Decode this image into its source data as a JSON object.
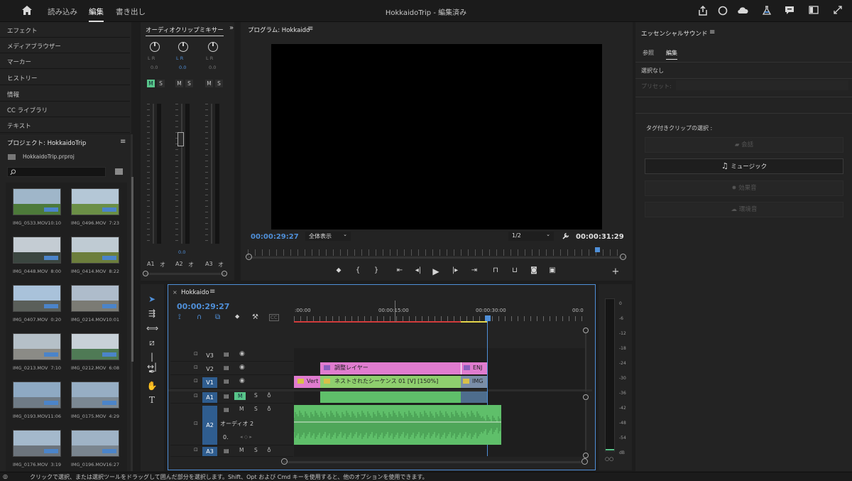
{
  "app": {
    "title": "HokkaidoTrip - 編集済み",
    "workspace_tabs": [
      "読み込み",
      "編集",
      "書き出し"
    ],
    "active_tab": "編集"
  },
  "left_nav": {
    "items": [
      "エフェクト",
      "メディアブラウザー",
      "マーカー",
      "ヒストリー",
      "情報",
      "CC ライブラリ",
      "テキスト"
    ]
  },
  "project": {
    "title": "プロジェクト: HokkaidoTrip",
    "file": "HokkaidoTrip.prproj",
    "search_placeholder": "",
    "clips": [
      {
        "name": "IMG_0533.MOV",
        "duration": "10:10",
        "sky": "#9fb6c9",
        "ground": "#4d7a3a"
      },
      {
        "name": "IMG_0496.MOV",
        "duration": "7:23",
        "sky": "#b4c7d6",
        "ground": "#6b8f46"
      },
      {
        "name": "IMG_0448.MOV",
        "duration": "8:00",
        "sky": "#c4ccd3",
        "ground": "#3b4640"
      },
      {
        "name": "IMG_0414.MOV",
        "duration": "8:22",
        "sky": "#bfcbd3",
        "ground": "#6c7e3c"
      },
      {
        "name": "IMG_0407.MOV",
        "duration": "0:20",
        "sky": "#a9c2da",
        "ground": "#5a5f5a"
      },
      {
        "name": "IMG_0214.MOV",
        "duration": "10:01",
        "sky": "#aebccb",
        "ground": "#7b7b74"
      },
      {
        "name": "IMG_0213.MOV",
        "duration": "7:10",
        "sky": "#b5c0c8",
        "ground": "#8b8b86"
      },
      {
        "name": "IMG_0212.MOV",
        "duration": "6:08",
        "sky": "#c8d1d8",
        "ground": "#4f7a55"
      },
      {
        "name": "IMG_0193.MOV",
        "duration": "11:06",
        "sky": "#8ea9c3",
        "ground": "#6f7b86"
      },
      {
        "name": "IMG_0175.MOV",
        "duration": "4:29",
        "sky": "#97aec4",
        "ground": "#7b8893"
      },
      {
        "name": "IMG_0176.MOV",
        "duration": "3:19",
        "sky": "#a4b9cc",
        "ground": "#6c747c"
      },
      {
        "name": "IMG_0196.MOV",
        "duration": "16:27",
        "sky": "#9fb3c6",
        "ground": "#7a858f"
      }
    ]
  },
  "mixer": {
    "title": "オーディオクリップミキサー",
    "channels": [
      {
        "name": "A1",
        "value": "0.0",
        "lr": "L  R",
        "fader_value": ""
      },
      {
        "name": "A2",
        "value": "0.0",
        "lr": "L  R",
        "fader_value": "0.0"
      },
      {
        "name": "A3",
        "value": "0.0",
        "lr": "L  R",
        "fader_value": ""
      }
    ],
    "m_label": "M",
    "s_label": "S",
    "mark_label": "オ"
  },
  "program": {
    "title": "プログラム: Hokkaido",
    "current_time": "00:00:29:27",
    "fit": "全体表示",
    "resolution": "1/2",
    "duration": "00:00:31:29"
  },
  "essential_sound": {
    "title": "エッセンシャルサウンド",
    "tabs": [
      "参照",
      "編集"
    ],
    "active_tab": "編集",
    "selection": "選択なし",
    "preset_label": "プリセット:",
    "tagged_label": "タグ付きクリップの選択 :",
    "buttons": [
      "会話",
      "ミュージック",
      "効果音",
      "環境音"
    ],
    "active_button": "ミュージック"
  },
  "timeline": {
    "sequence": "Hokkaido",
    "timecode": "00:00:29:27",
    "ruler": [
      ":00:00",
      "00:00:15:00",
      "00:00:30:00",
      "00:0"
    ],
    "tracks": [
      "V3",
      "V2",
      "V1",
      "A1",
      "A2",
      "A3"
    ],
    "a2_name": "オーディオ 2",
    "a2_vol": "0.",
    "clips": {
      "adj": "調整レイヤー",
      "adj_end": "ENJ",
      "vert": "Vert",
      "nested": "ネストされたシーケンス 01 [V] [150%]",
      "img": "IMG"
    },
    "db_scale": [
      "0",
      "-6",
      "-12",
      "-18",
      "-24",
      "-30",
      "-36",
      "-42",
      "-48",
      "-54",
      "dB"
    ],
    "accent": "#4f8fd8",
    "video_color": "#e07ccf",
    "audio_color": "#5fbf6a",
    "nested_color": "#8ecf6e"
  },
  "status_text": "クリックで選択、または選択ツールをドラッグして囲んだ部分を選択します。Shift、Opt および Cmd キーを使用すると、他のオプションを使用できます。"
}
